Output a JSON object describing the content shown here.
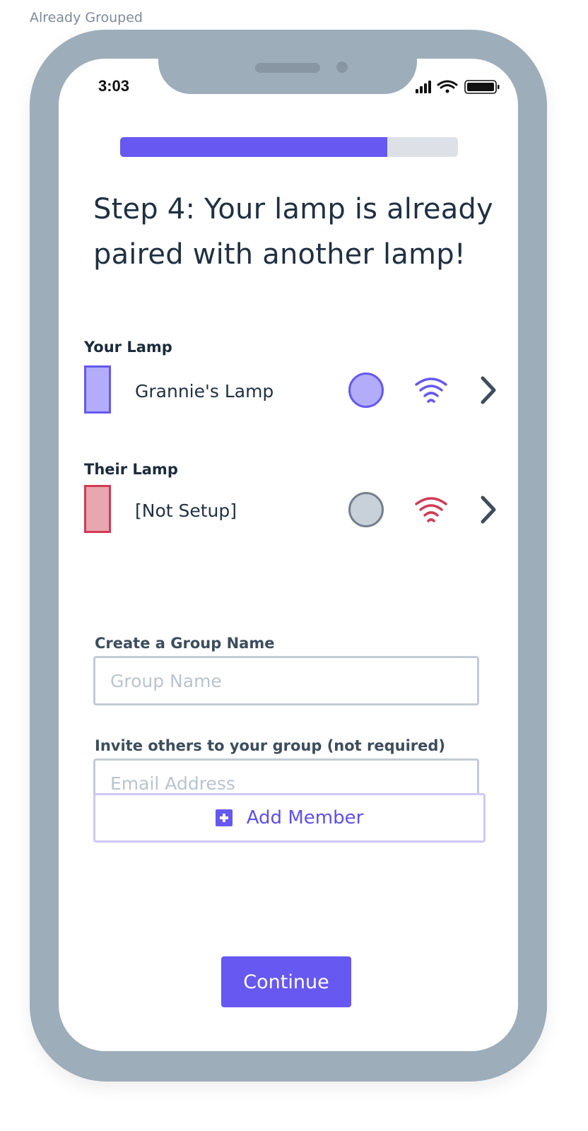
{
  "frame_label": "Already Grouped",
  "status_bar": {
    "time": "3:03"
  },
  "progress": {
    "fraction": 0.79,
    "fill_color": "#6658f1",
    "track_color": "#dde1e7"
  },
  "title": "Step 4: Your lamp is already paired with another lamp!",
  "your_lamp": {
    "section_label": "Your Lamp",
    "name": "Grannie's Lamp",
    "swatch_color": "#b3acf9",
    "swatch_border": "#6658f1",
    "status_icon": "circle-icon",
    "signal_icon": "wifi-icon",
    "signal_color": "#6658f1"
  },
  "their_lamp": {
    "section_label": "Their Lamp",
    "name": "[Not Setup]",
    "swatch_color": "#e8a6b0",
    "swatch_border": "#d23a55",
    "status_icon": "circle-icon",
    "signal_icon": "wifi-icon",
    "signal_color": "#d23a55"
  },
  "group_name": {
    "label": "Create a Group Name",
    "placeholder": "Group Name",
    "value": ""
  },
  "invite": {
    "label": "Invite others to your group (not required)",
    "placeholder": "Email Address",
    "value": ""
  },
  "add_member": {
    "label": "Add Member",
    "icon": "plus-icon"
  },
  "continue": {
    "label": "Continue"
  }
}
